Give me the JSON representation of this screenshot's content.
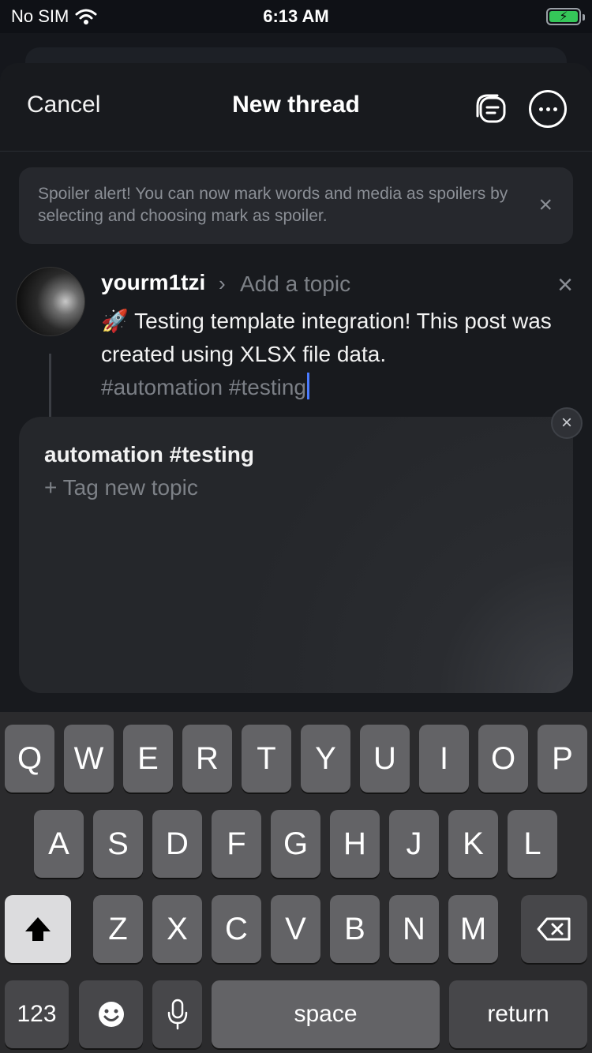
{
  "status_bar": {
    "carrier": "No SIM",
    "time": "6:13 AM",
    "battery_color": "#35c759"
  },
  "nav": {
    "cancel_label": "Cancel",
    "title": "New thread",
    "drafts_icon": "drafts-icon",
    "more_icon": "more-options-icon"
  },
  "banner": {
    "text": "Spoiler alert! You can now mark words and media as spoilers by selecting and choosing mark as spoiler."
  },
  "post": {
    "username": "yourm1tzi",
    "topic_placeholder": "Add a topic",
    "emoji": "🚀",
    "text": "Testing template integration! This post was created using XLSX file data.",
    "hashtags": "#automation #testing"
  },
  "topic_suggestions": {
    "items": [
      "automation #testing"
    ],
    "new_topic_label": "+ Tag new topic"
  },
  "keyboard": {
    "row1": [
      "Q",
      "W",
      "E",
      "R",
      "T",
      "Y",
      "U",
      "I",
      "O",
      "P"
    ],
    "row2": [
      "A",
      "S",
      "D",
      "F",
      "G",
      "H",
      "J",
      "K",
      "L"
    ],
    "row3": [
      "Z",
      "X",
      "C",
      "V",
      "B",
      "N",
      "M"
    ],
    "numbers_label": "123",
    "space_label": "space",
    "return_label": "return"
  },
  "colors": {
    "accent_cursor": "#4a7bff",
    "background": "#181a1e"
  }
}
